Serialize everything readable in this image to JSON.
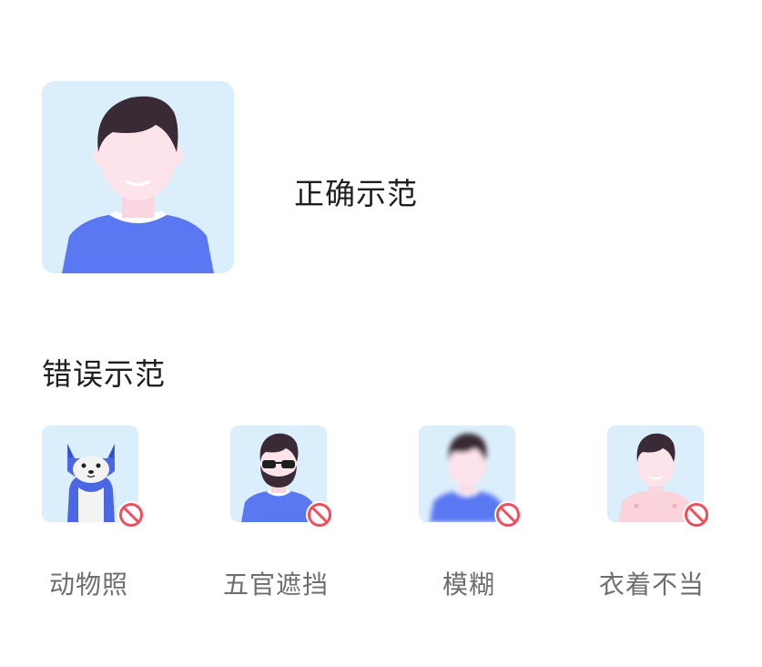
{
  "correct": {
    "label": "正确示范",
    "icon": "avatar-correct-icon"
  },
  "wrong": {
    "heading": "错误示范",
    "items": [
      {
        "caption": "动物照",
        "icon": "animal-photo-icon"
      },
      {
        "caption": "五官遮挡",
        "icon": "sunglasses-beard-icon"
      },
      {
        "caption": "模糊",
        "icon": "blurry-photo-icon"
      },
      {
        "caption": "衣着不当",
        "icon": "shirtless-photo-icon"
      }
    ],
    "badge_icon": "prohibited-icon"
  },
  "colors": {
    "card_background": "#dbeefc",
    "shirt_blue": "#5a78f2",
    "hair": "#3a2a36",
    "skin": "#fde4ea",
    "prohibited_red": "#f04e5e"
  }
}
